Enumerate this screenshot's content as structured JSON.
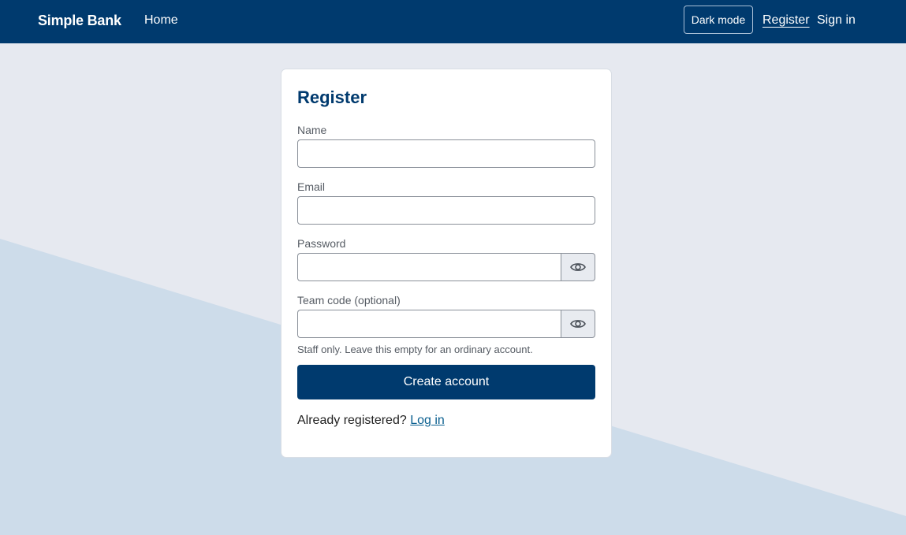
{
  "navbar": {
    "brand": "Simple Bank",
    "home_label": "Home",
    "dark_mode_label": "Dark mode",
    "register_label": "Register",
    "sign_in_label": "Sign in"
  },
  "form": {
    "title": "Register",
    "name_label": "Name",
    "name_value": "",
    "email_label": "Email",
    "email_value": "",
    "password_label": "Password",
    "password_value": "",
    "team_code_label": "Team code (optional)",
    "team_code_value": "",
    "team_code_help": "Staff only. Leave this empty for an ordinary account.",
    "submit_label": "Create account",
    "already_registered": "Already registered?",
    "login_link": "Log in"
  },
  "icons": {
    "password_toggle": "eye-icon",
    "team_code_toggle": "eye-icon"
  },
  "colors": {
    "navbar": "#003a6e",
    "primary": "#003a6e",
    "background": "#e6e9f0",
    "background_accent": "#cddcea",
    "link": "#0a5f8f"
  }
}
